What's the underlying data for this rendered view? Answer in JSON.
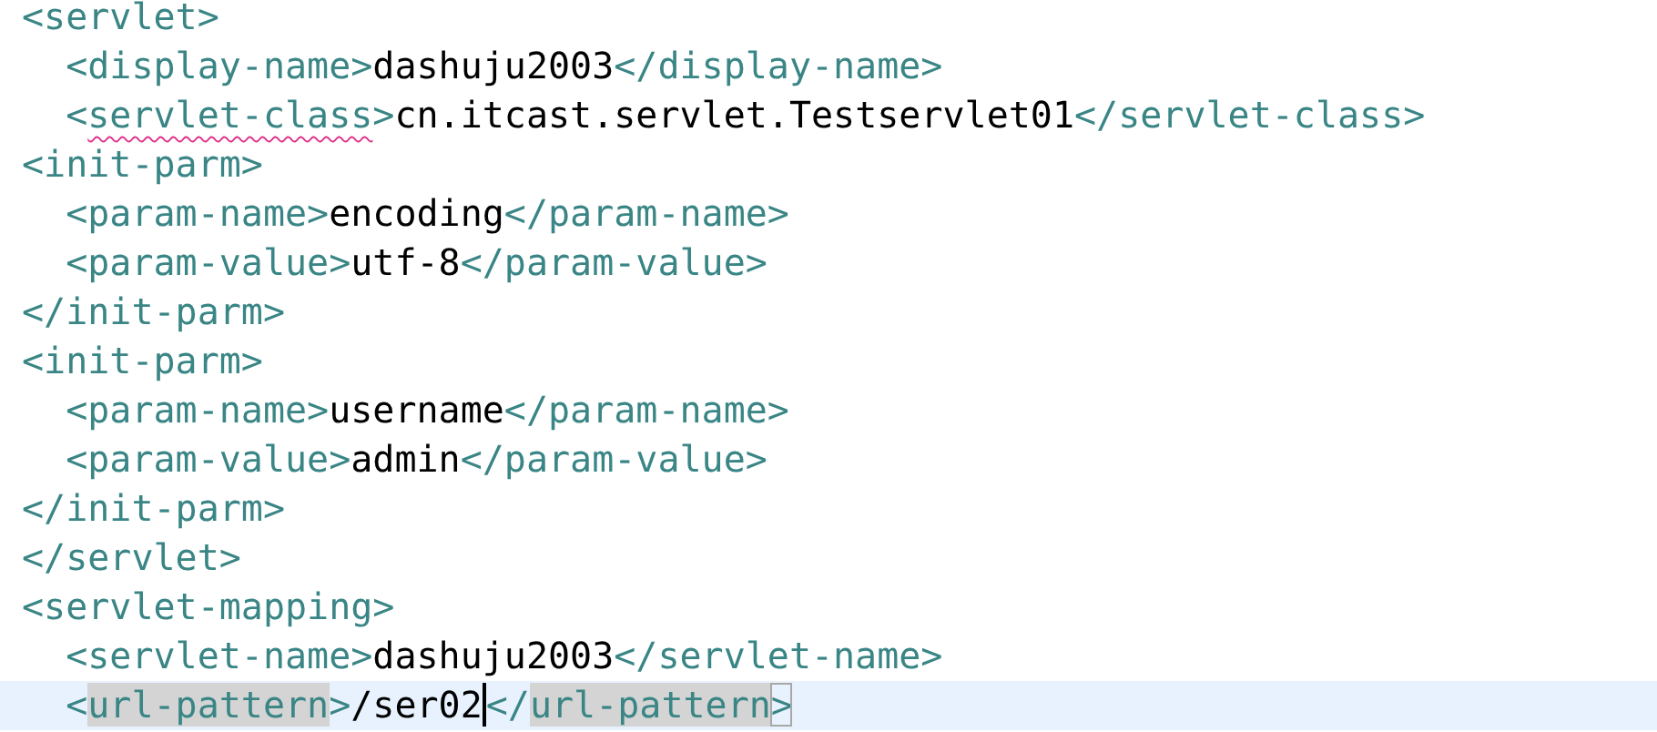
{
  "editor": {
    "lines": [
      {
        "current": false,
        "segments": [
          {
            "kind": "tag",
            "text": "<servlet>"
          }
        ]
      },
      {
        "current": false,
        "segments": [
          {
            "kind": "tag",
            "text": "  <display-name>"
          },
          {
            "kind": "text",
            "text": "dashuju2003"
          },
          {
            "kind": "tag",
            "text": "</display-name>"
          }
        ]
      },
      {
        "current": false,
        "segments": [
          {
            "kind": "tag",
            "text": "  <"
          },
          {
            "kind": "tag",
            "text": "servlet-class",
            "misspelled": true
          },
          {
            "kind": "tag",
            "text": ">"
          },
          {
            "kind": "text",
            "text": "cn.itcast.servlet.Testservlet01"
          },
          {
            "kind": "tag",
            "text": "</servlet-class>"
          }
        ]
      },
      {
        "current": false,
        "segments": [
          {
            "kind": "tag",
            "text": "<init-parm>"
          }
        ]
      },
      {
        "current": false,
        "segments": [
          {
            "kind": "tag",
            "text": "  <param-name>"
          },
          {
            "kind": "text",
            "text": "encoding"
          },
          {
            "kind": "tag",
            "text": "</param-name>"
          }
        ]
      },
      {
        "current": false,
        "segments": [
          {
            "kind": "tag",
            "text": "  <param-value>"
          },
          {
            "kind": "text",
            "text": "utf-8"
          },
          {
            "kind": "tag",
            "text": "</param-value>"
          }
        ]
      },
      {
        "current": false,
        "segments": [
          {
            "kind": "tag",
            "text": "</init-parm>"
          }
        ]
      },
      {
        "current": false,
        "segments": [
          {
            "kind": "tag",
            "text": "<init-parm>"
          }
        ]
      },
      {
        "current": false,
        "segments": [
          {
            "kind": "tag",
            "text": "  <param-name>"
          },
          {
            "kind": "text",
            "text": "username"
          },
          {
            "kind": "tag",
            "text": "</param-name>"
          }
        ]
      },
      {
        "current": false,
        "segments": [
          {
            "kind": "tag",
            "text": "  <param-value>"
          },
          {
            "kind": "text",
            "text": "admin"
          },
          {
            "kind": "tag",
            "text": "</param-value>"
          }
        ]
      },
      {
        "current": false,
        "segments": [
          {
            "kind": "tag",
            "text": "</init-parm>"
          }
        ]
      },
      {
        "current": false,
        "segments": [
          {
            "kind": "tag",
            "text": "</servlet>"
          }
        ]
      },
      {
        "current": false,
        "segments": [
          {
            "kind": "tag",
            "text": "<servlet-mapping>"
          }
        ]
      },
      {
        "current": false,
        "segments": [
          {
            "kind": "tag",
            "text": "  <servlet-name>"
          },
          {
            "kind": "text",
            "text": "dashuju2003"
          },
          {
            "kind": "tag",
            "text": "</servlet-name>"
          }
        ]
      },
      {
        "current": true,
        "segments": [
          {
            "kind": "tag",
            "text": "  <"
          },
          {
            "kind": "tag",
            "text": "url-pattern",
            "highlighted": true
          },
          {
            "kind": "tag",
            "text": ">"
          },
          {
            "kind": "text",
            "text": "/ser02",
            "caret_after": true
          },
          {
            "kind": "tag",
            "text": "</"
          },
          {
            "kind": "tag",
            "text": "url-pattern",
            "highlighted": true
          },
          {
            "kind": "tag",
            "text": ">",
            "matched_bracket": true
          }
        ]
      }
    ]
  }
}
